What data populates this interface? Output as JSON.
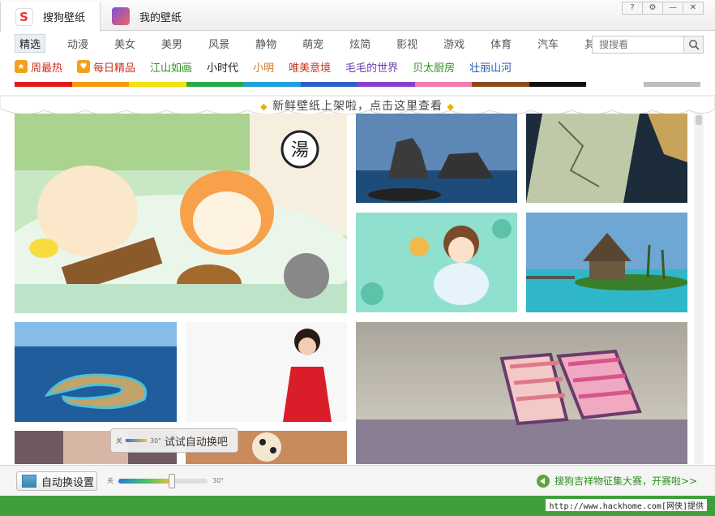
{
  "window_controls": [
    "?",
    "⚙",
    "—",
    "✕"
  ],
  "tabs": [
    {
      "label": "搜狗壁纸"
    },
    {
      "label": "我的壁纸"
    }
  ],
  "categories": [
    "精选",
    "动漫",
    "美女",
    "美男",
    "风景",
    "静物",
    "萌宠",
    "炫简",
    "影视",
    "游戏",
    "体育",
    "汽车",
    "其他"
  ],
  "search": {
    "placeholder": "搜搜看"
  },
  "subcategories": [
    {
      "label": "周最热",
      "color": "#c8321e",
      "icon": "star-icon"
    },
    {
      "label": "每日精品",
      "color": "#c8321e",
      "icon": "heart-icon"
    },
    {
      "label": "江山如画",
      "color": "#2e8f1f"
    },
    {
      "label": "小时代",
      "color": "#222222"
    },
    {
      "label": "小明",
      "color": "#d77a1e"
    },
    {
      "label": "唯美意境",
      "color": "#c8321e"
    },
    {
      "label": "毛毛的世界",
      "color": "#6a3fa8"
    },
    {
      "label": "贝太厨房",
      "color": "#2e8f1f"
    },
    {
      "label": "壮丽山河",
      "color": "#2a5db0"
    }
  ],
  "color_bar": [
    "#e01919",
    "#f39c12",
    "#f5e10a",
    "#2aa84a",
    "#1ea0d8",
    "#2d5fc6",
    "#8a3fc6",
    "#f07cb4",
    "#8a4a1e",
    "#111111",
    "#ffffff",
    "#bdbdbd"
  ],
  "notice": "新鲜壁纸上架啦，点击这里查看",
  "tooltip": {
    "text": "试试自动换吧",
    "min": "关",
    "max": "30\""
  },
  "bottom": {
    "auto_label": "自动换设置",
    "slider_min": "关",
    "slider_max": "30\"",
    "slider_value": 0.6,
    "promo": "搜狗吉祥物征集大赛，开赛啦>>"
  },
  "watermark": "http://www.hackhome.com[网侠]提供"
}
